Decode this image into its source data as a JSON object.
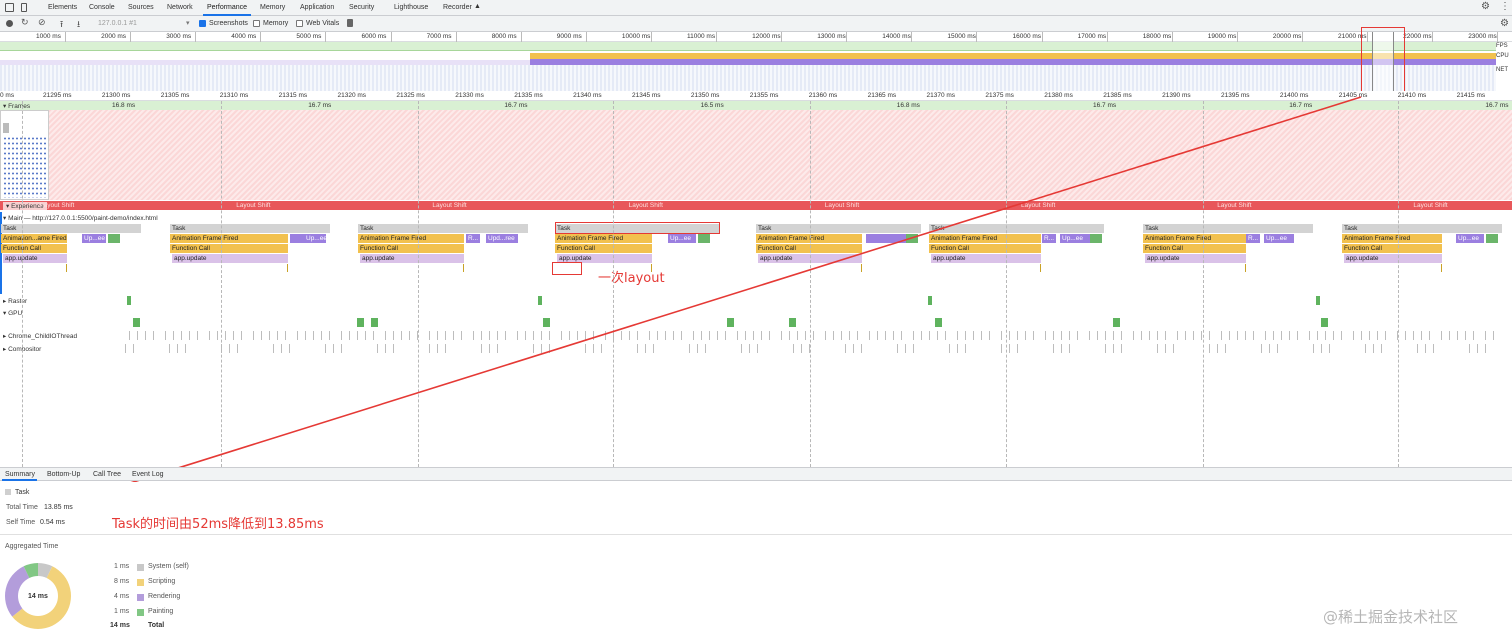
{
  "tabs": [
    "Elements",
    "Console",
    "Sources",
    "Network",
    "Performance",
    "Memory",
    "Application",
    "Security",
    "Lighthouse",
    "Recorder"
  ],
  "toolbar": {
    "url_select": "127.0.0.1 #1",
    "screenshots_label": "Screenshots",
    "memory_label": "Memory",
    "webvitals_label": "Web Vitals"
  },
  "overview": {
    "ticks": [
      "1000 ms",
      "2000 ms",
      "3000 ms",
      "4000 ms",
      "5000 ms",
      "6000 ms",
      "7000 ms",
      "8000 ms",
      "9000 ms",
      "10000 ms",
      "11000 ms",
      "12000 ms",
      "13000 ms",
      "14000 ms",
      "15000 ms",
      "16000 ms",
      "17000 ms",
      "18000 ms",
      "19000 ms",
      "20000 ms",
      "21000 ms",
      "22000 ms",
      "23000 ms"
    ],
    "fps_label": "FPS",
    "cpu_label": "CPU",
    "net_label": "NET"
  },
  "timeline": {
    "ticks": [
      "0 ms",
      "21295 ms",
      "21300 ms",
      "21305 ms",
      "21310 ms",
      "21315 ms",
      "21320 ms",
      "21325 ms",
      "21330 ms",
      "21335 ms",
      "21340 ms",
      "21345 ms",
      "21350 ms",
      "21355 ms",
      "21360 ms",
      "21365 ms",
      "21370 ms",
      "21375 ms",
      "21380 ms",
      "21385 ms",
      "21390 ms",
      "21395 ms",
      "21400 ms",
      "21405 ms",
      "21410 ms",
      "21415 ms"
    ],
    "frames_label": "Frames",
    "frame_times": [
      "16.8 ms",
      "16.7 ms",
      "16.7 ms",
      "16.5 ms",
      "16.8 ms",
      "16.7 ms",
      "16.7 ms",
      "16.7 ms"
    ],
    "experience_label": "Experience",
    "layout_shift_label": "Layout Shift",
    "main_label": "Main — http://127.0.0.1:5500/paint-demo/index.html",
    "raster_label": "Raster",
    "gpu_label": "GPU",
    "chrome_label": "Chrome_ChildIOThread",
    "compositor_label": "Compositor"
  },
  "flame": {
    "task": "Task",
    "anim_short": "Animation...ame Fired",
    "anim": "Animation Frame Fired",
    "function_call": "Function Call",
    "app_update": "app.update",
    "upd1": "Up...ee",
    "upd2": "Upd...ree",
    "upd3": "Up...ee",
    "r": "R..."
  },
  "bottom_tabs": [
    "Summary",
    "Bottom-Up",
    "Call Tree",
    "Event Log"
  ],
  "summary": {
    "title": "Task",
    "total_time_label": "Total Time",
    "total_time": "13.85 ms",
    "self_time_label": "Self Time",
    "self_time": "0.54 ms",
    "aggregated_label": "Aggregated Time",
    "donut_center": "14 ms",
    "rows": [
      {
        "value": "1 ms",
        "label": "System (self)",
        "color": "#c8c8c8"
      },
      {
        "value": "8 ms",
        "label": "Scripting",
        "color": "#f2d27a"
      },
      {
        "value": "4 ms",
        "label": "Rendering",
        "color": "#b39ddb"
      },
      {
        "value": "1 ms",
        "label": "Painting",
        "color": "#81c784"
      }
    ],
    "total_value": "14 ms",
    "total_label": "Total"
  },
  "annotations": {
    "layout_note": "一次layout",
    "task_note": "Task的时间由52ms降低到13.85ms",
    "watermark": "@稀土掘金技术社区"
  },
  "colors": {
    "accent": "#1a73e8",
    "annotation": "#e53935",
    "layout_shift": "#e8575a"
  }
}
